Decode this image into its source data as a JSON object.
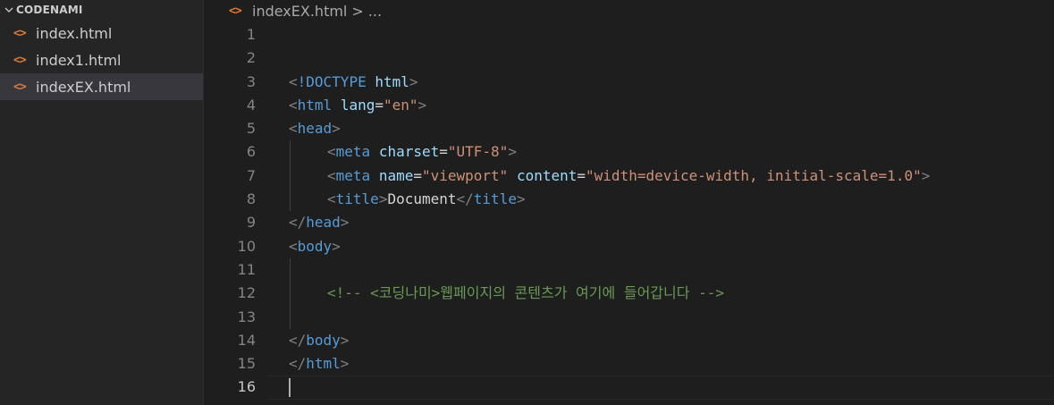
{
  "explorer": {
    "folder_name": "CODENAMI",
    "files": [
      {
        "name": "index.html",
        "icon": "html-file-icon"
      },
      {
        "name": "index1.html",
        "icon": "html-file-icon"
      },
      {
        "name": "indexEX.html",
        "icon": "html-file-icon",
        "active": true
      }
    ]
  },
  "breadcrumb": {
    "file": "indexEX.html",
    "separator": ">",
    "more": "..."
  },
  "editor": {
    "current_line": 16,
    "lines": [
      {
        "n": "1",
        "tokens": []
      },
      {
        "n": "2",
        "tokens": []
      },
      {
        "n": "3",
        "tokens": [
          [
            "p",
            "<"
          ],
          [
            "t",
            "!DOCTYPE"
          ],
          [
            "w",
            " "
          ],
          [
            "a",
            "html"
          ],
          [
            "p",
            ">"
          ]
        ]
      },
      {
        "n": "4",
        "tokens": [
          [
            "p",
            "<"
          ],
          [
            "t",
            "html"
          ],
          [
            "w",
            " "
          ],
          [
            "a",
            "lang"
          ],
          [
            "w",
            "="
          ],
          [
            "s",
            "\"en\""
          ],
          [
            "p",
            ">"
          ]
        ]
      },
      {
        "n": "5",
        "tokens": [
          [
            "p",
            "<"
          ],
          [
            "t",
            "head"
          ],
          [
            "p",
            ">"
          ]
        ]
      },
      {
        "n": "6",
        "indent": 1,
        "tokens": [
          [
            "p",
            "<"
          ],
          [
            "t",
            "meta"
          ],
          [
            "w",
            " "
          ],
          [
            "a",
            "charset"
          ],
          [
            "w",
            "="
          ],
          [
            "s",
            "\"UTF-8\""
          ],
          [
            "p",
            ">"
          ]
        ]
      },
      {
        "n": "7",
        "indent": 1,
        "tokens": [
          [
            "p",
            "<"
          ],
          [
            "t",
            "meta"
          ],
          [
            "w",
            " "
          ],
          [
            "a",
            "name"
          ],
          [
            "w",
            "="
          ],
          [
            "s",
            "\"viewport\""
          ],
          [
            "w",
            " "
          ],
          [
            "a",
            "content"
          ],
          [
            "w",
            "="
          ],
          [
            "s",
            "\"width=device-width, initial-scale=1.0\""
          ],
          [
            "p",
            ">"
          ]
        ]
      },
      {
        "n": "8",
        "indent": 1,
        "tokens": [
          [
            "p",
            "<"
          ],
          [
            "t",
            "title"
          ],
          [
            "p",
            ">"
          ],
          [
            "w",
            "Document"
          ],
          [
            "p",
            "</"
          ],
          [
            "t",
            "title"
          ],
          [
            "p",
            ">"
          ]
        ]
      },
      {
        "n": "9",
        "tokens": [
          [
            "p",
            "</"
          ],
          [
            "t",
            "head"
          ],
          [
            "p",
            ">"
          ]
        ]
      },
      {
        "n": "10",
        "tokens": [
          [
            "p",
            "<"
          ],
          [
            "t",
            "body"
          ],
          [
            "p",
            ">"
          ]
        ]
      },
      {
        "n": "11",
        "guide": true,
        "tokens": []
      },
      {
        "n": "12",
        "indent": 1,
        "tokens": [
          [
            "c",
            "<!-- <코딩나미>웹페이지의 콘텐츠가 여기에 들어갑니다 -->"
          ]
        ]
      },
      {
        "n": "13",
        "guide": true,
        "tokens": []
      },
      {
        "n": "14",
        "tokens": [
          [
            "p",
            "</"
          ],
          [
            "t",
            "body"
          ],
          [
            "p",
            ">"
          ]
        ]
      },
      {
        "n": "15",
        "tokens": [
          [
            "p",
            "</"
          ],
          [
            "t",
            "html"
          ],
          [
            "p",
            ">"
          ]
        ]
      },
      {
        "n": "16",
        "tokens": [],
        "cursor": true
      }
    ]
  },
  "colors": {
    "punctuation": "#808080",
    "tag": "#569cd6",
    "attribute": "#9cdcfe",
    "string": "#ce9178",
    "comment": "#6a9955",
    "html_icon": "#e37933"
  }
}
